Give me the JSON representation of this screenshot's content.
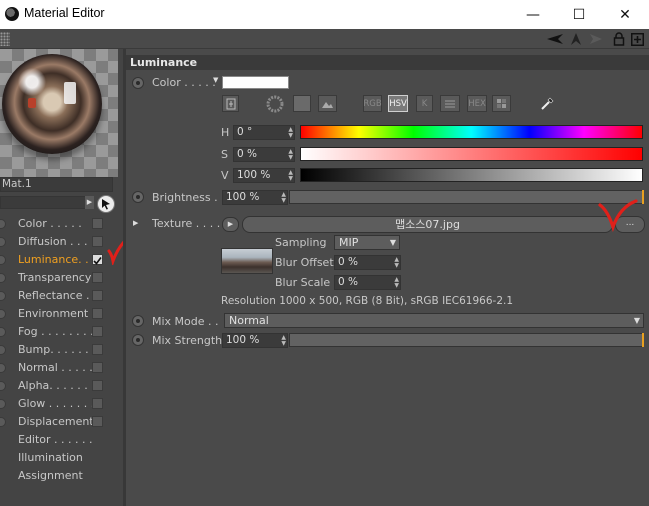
{
  "window": {
    "title": "Material Editor",
    "minimize": "—",
    "maximize": "☐",
    "close": "✕"
  },
  "material": {
    "name": "Mat.1"
  },
  "channels": [
    {
      "label": "Color . . . . .",
      "checked": false,
      "active": false
    },
    {
      "label": "Diffusion . . . .",
      "checked": false,
      "active": false
    },
    {
      "label": "Luminance. . .",
      "checked": true,
      "active": true
    },
    {
      "label": "Transparency",
      "checked": false,
      "active": false
    },
    {
      "label": "Reflectance . .",
      "checked": false,
      "active": false
    },
    {
      "label": "Environment",
      "checked": false,
      "active": false
    },
    {
      "label": "Fog . . . . . . . .",
      "checked": false,
      "active": false
    },
    {
      "label": "Bump. . . . . . .",
      "checked": false,
      "active": false
    },
    {
      "label": "Normal . . . . .",
      "checked": false,
      "active": false
    },
    {
      "label": "Alpha. . . . . . .",
      "checked": false,
      "active": false
    },
    {
      "label": "Glow . . . . . . .",
      "checked": false,
      "active": false
    },
    {
      "label": "Displacement",
      "checked": false,
      "active": false
    },
    {
      "label": "Editor . . . . . .",
      "checked": null,
      "active": false
    },
    {
      "label": "Illumination",
      "checked": null,
      "active": false
    },
    {
      "label": "Assignment",
      "checked": null,
      "active": false
    }
  ],
  "luminance": {
    "section_title": "Luminance",
    "color_label": "Color . . . . .",
    "color_value": "#ffffff",
    "modes": [
      "RGB",
      "HSV",
      "K",
      "",
      "HEX",
      ""
    ],
    "selected_mode": "HSV",
    "h_label": "H",
    "h_value": "0 °",
    "s_label": "S",
    "s_value": "0 %",
    "v_label": "V",
    "v_value": "100 %",
    "brightness_label": "Brightness . .",
    "brightness_value": "100 %",
    "texture_label": "Texture . . . .",
    "texture_file": "맵소스07.jpg",
    "texture_more": "...",
    "sampling_label": "Sampling",
    "sampling_value": "MIP",
    "blur_offset_label": "Blur Offset",
    "blur_offset_value": "0 %",
    "blur_scale_label": "Blur Scale",
    "blur_scale_value": "0 %",
    "resolution_text": "Resolution 1000 x 500, RGB (8 Bit), sRGB IEC61966-2.1",
    "mix_mode_label": "Mix Mode . .",
    "mix_mode_value": "Normal",
    "mix_strength_label": "Mix Strength",
    "mix_strength_value": "100 %"
  },
  "colors": {
    "accent": "#f0a020",
    "annotation": "#e0201a"
  }
}
